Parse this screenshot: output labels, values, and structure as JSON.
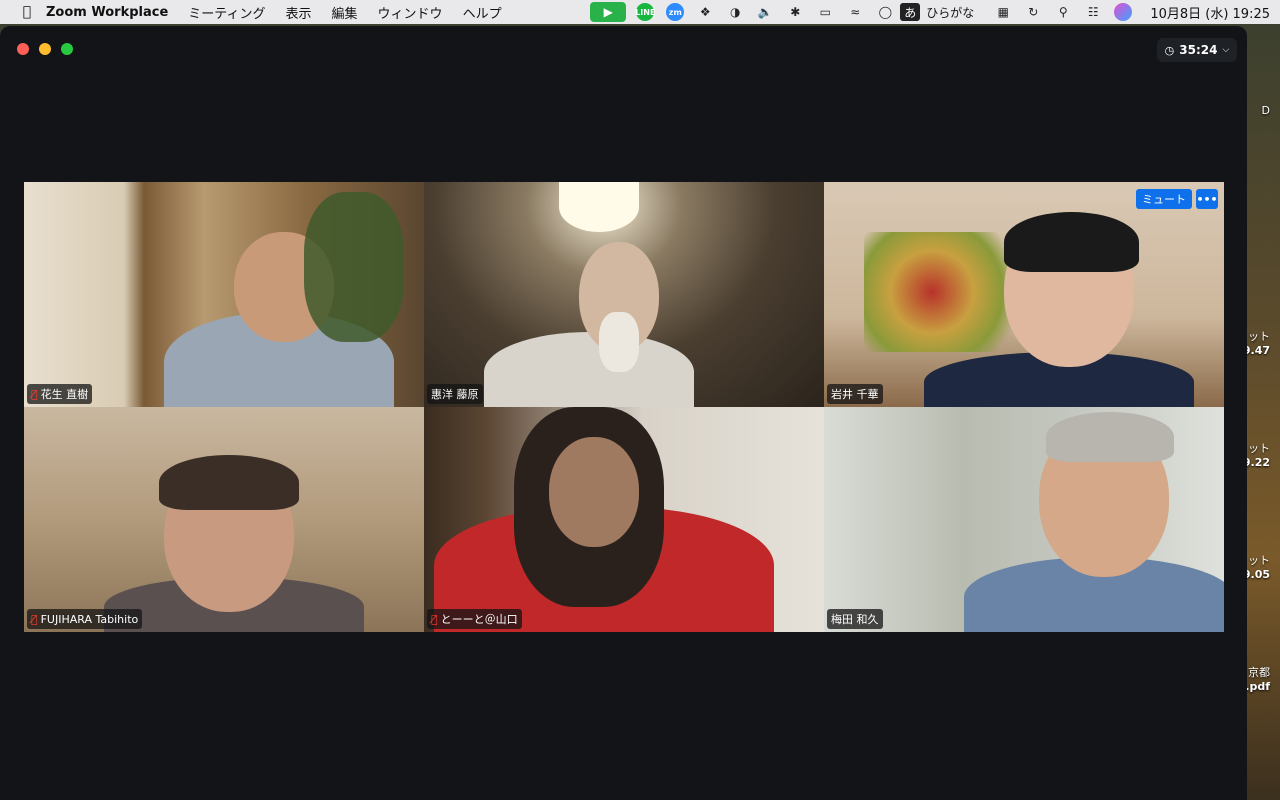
{
  "menubar": {
    "app_name": "Zoom Workplace",
    "menus": [
      "ミーティング",
      "表示",
      "編集",
      "ウィンドウ",
      "ヘルプ"
    ],
    "ime_glyph": "あ",
    "ime_label": "ひらがな",
    "datetime": "10月8日 (水)  19:25",
    "status_icons": [
      "zoom-video-icon",
      "line-icon",
      "zoom-icon",
      "dropbox-icon",
      "night-owl-icon",
      "volume-icon",
      "bluetooth-icon",
      "battery-icon",
      "wifi-icon",
      "user-icon",
      "keyboard-icon",
      "time-machine-icon",
      "search-icon",
      "control-center-icon",
      "siri-icon"
    ]
  },
  "desktop_labels": [
    {
      "line1": "ット",
      "line2": "9.47"
    },
    {
      "line1": "ット",
      "line2": "9.22"
    },
    {
      "line1": "ット",
      "line2": "9.05"
    },
    {
      "line1": "京都",
      "line2": ".pdf"
    },
    {
      "line1": "D",
      "line2": ""
    }
  ],
  "window": {
    "timer": "35:24"
  },
  "participants": [
    {
      "name": "花生 直樹",
      "muted": true,
      "speaking": false
    },
    {
      "name": "惠洋 藤原",
      "muted": false,
      "speaking": true
    },
    {
      "name": "岩井 千華",
      "muted": false,
      "speaking": false,
      "mute_label": "ミュート",
      "more_label": "•••"
    },
    {
      "name": "FUJIHARA Tabihito",
      "muted": true,
      "speaking": false
    },
    {
      "name": "とーーと＠山口",
      "muted": true,
      "speaking": false
    },
    {
      "name": "梅田 和久",
      "muted": false,
      "speaking": false
    }
  ]
}
